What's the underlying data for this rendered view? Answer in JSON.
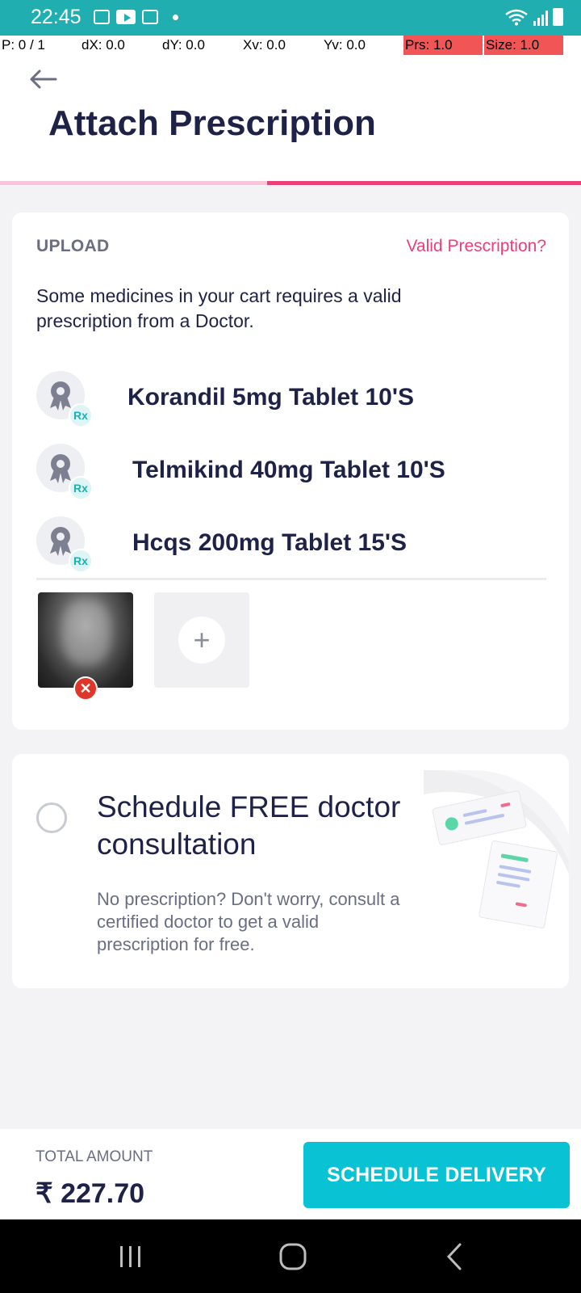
{
  "status_bar": {
    "time": "22:45"
  },
  "debug": {
    "p": "P: 0 / 1",
    "dx": "dX: 0.0",
    "dy": "dY: 0.0",
    "xv": "Xv: 0.0",
    "yv": "Yv: 0.0",
    "prs": "Prs: 1.0",
    "size": "Size: 1.0"
  },
  "header": {
    "title": "Attach Prescription",
    "progress": 0.54
  },
  "upload": {
    "label": "UPLOAD",
    "valid_link": "Valid Prescription?",
    "description": "Some medicines in your cart requires a valid prescription from a Doctor.",
    "rx_label": "Rx",
    "medicines": [
      {
        "name": "Korandil 5mg Tablet 10'S"
      },
      {
        "name": "Telmikind 40mg Tablet 10'S"
      },
      {
        "name": "Hcqs 200mg Tablet 15'S"
      }
    ],
    "add_symbol": "+",
    "remove_symbol": "✕"
  },
  "consult": {
    "title": "Schedule FREE doctor consultation",
    "description": "No prescription? Don't worry, consult a certified doctor to get a valid prescription for free."
  },
  "footer": {
    "total_label": "TOTAL AMOUNT",
    "total_amount": "₹ 227.70",
    "button_label": "SCHEDULE DELIVERY"
  },
  "colors": {
    "status_bar": "#21aeb0",
    "accent_pink": "#ed3f77",
    "button": "#09c2d4",
    "text_dark": "#1e2247"
  }
}
